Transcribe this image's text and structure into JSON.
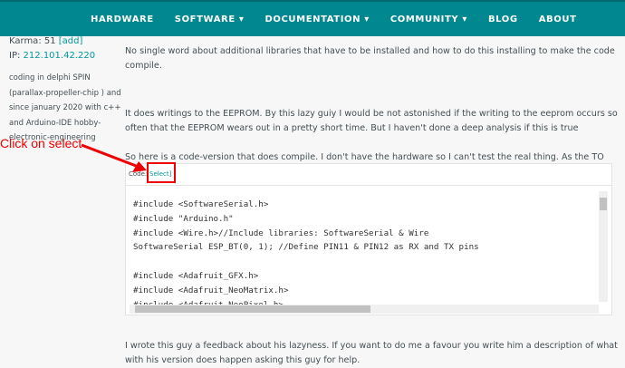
{
  "nav": [
    "HARDWARE",
    "SOFTWARE ▾",
    "DOCUMENTATION ▾",
    "COMMUNITY ▾",
    "BLOG",
    "ABOUT"
  ],
  "sidebar": {
    "karma_label": "Karma: 51",
    "karma_add": "[add]",
    "ip_label": "IP:",
    "ip": "212.101.42.220",
    "bio": "coding in delphi SPIN (parallax-propeller-chip ) and since january 2020 with c++ and Arduino-IDE hobby-electronic-engineering"
  },
  "post": {
    "p1": "No single word about additional libraries that have to be installed and how to do this installing to make the code compile.",
    "p2": "It does writings to the EEPROM. By this lazy guiy I would be not astonished if the writing to the eeprom occurs so often that the EEPROM wears out in a pretty short time. But I haven't done a deep analysis if this is true",
    "p3": "So here is a code-version that does compile. I don't have the hardware so I can't test the real thing. As the TO has the hardware you could give it a try.",
    "p4": "I wrote this guy a feedback about his lazyness. If you want to do me a favour you write him a description of what with his version does happen asking this guy for help."
  },
  "code": {
    "label": "Code:",
    "select": "[Select]",
    "text": "#include <SoftwareSerial.h>\n#include \"Arduino.h\"\n#include <Wire.h>//Include libraries: SoftwareSerial & Wire\nSoftwareSerial ESP_BT(0, 1); //Define PIN11 & PIN12 as RX and TX pins\n\n#include <Adafruit_GFX.h>\n#include <Adafruit_NeoMatrix.h>\n#include <Adafruit_NeoPixel.h>"
  },
  "annotation": "Click on select"
}
